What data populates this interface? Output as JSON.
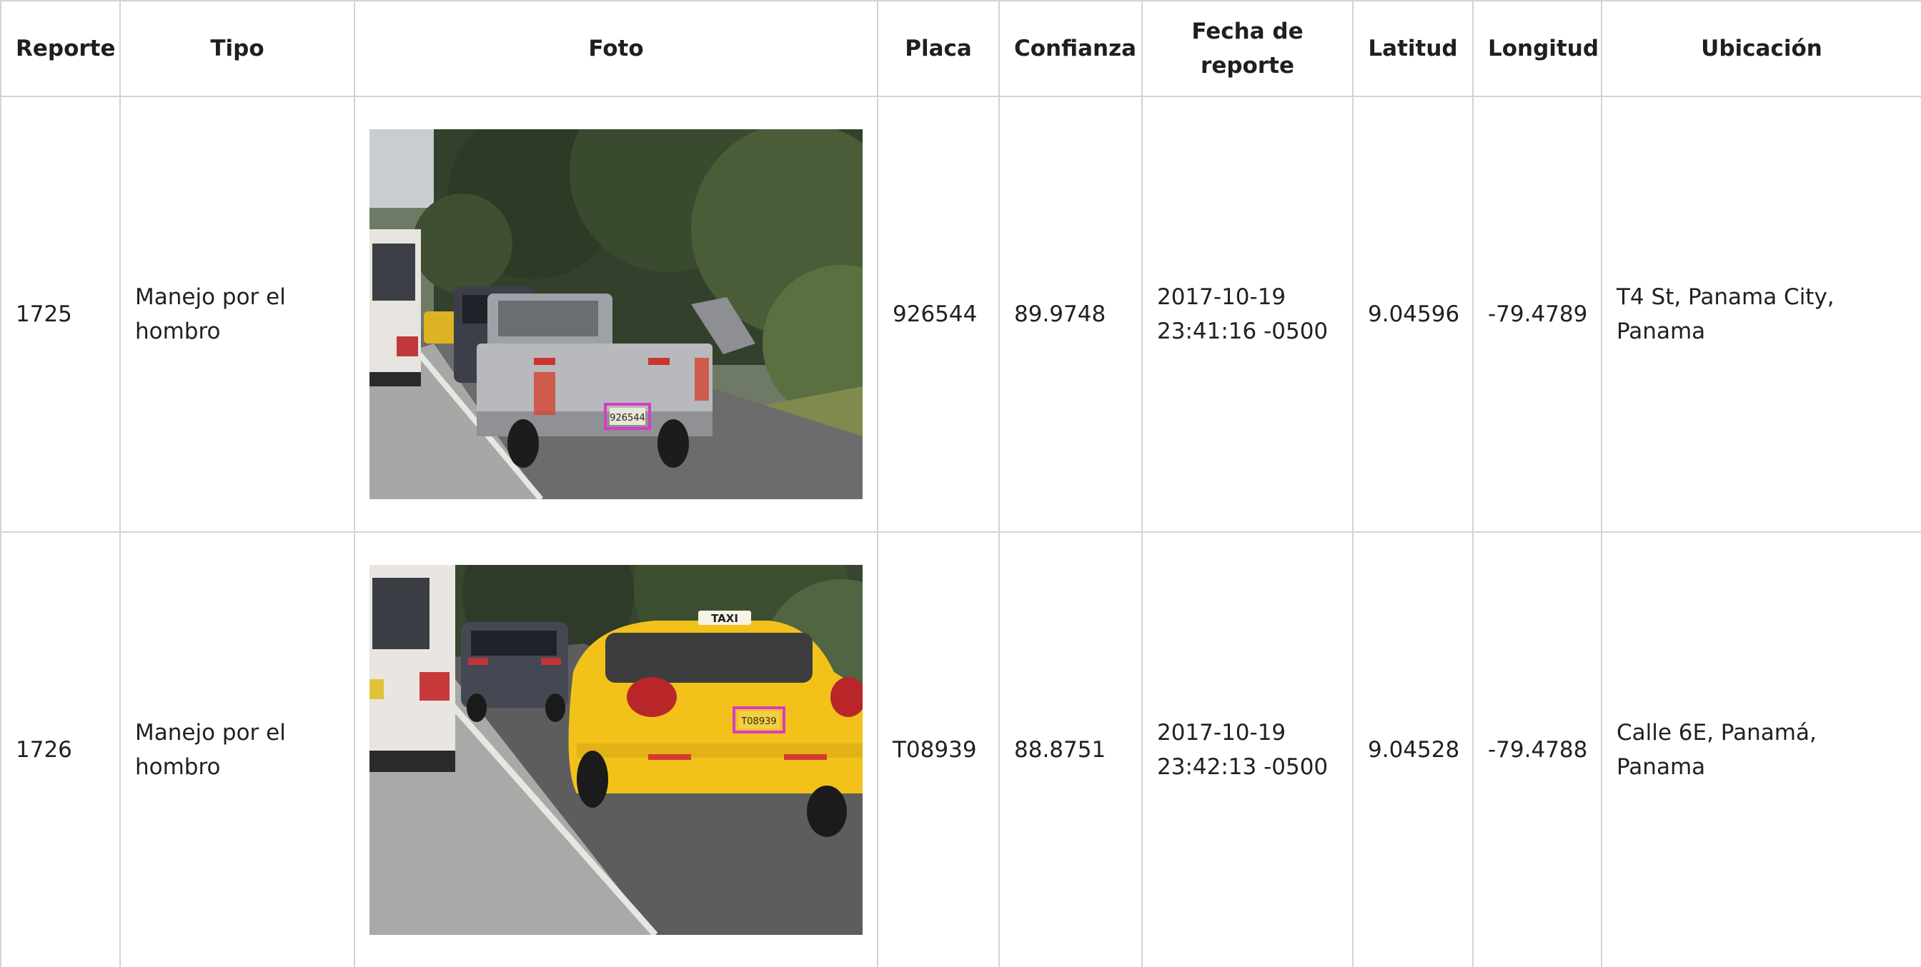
{
  "table": {
    "headers": {
      "reporte": "Reporte",
      "tipo": "Tipo",
      "foto": "Foto",
      "placa": "Placa",
      "confianza": "Confianza",
      "fecha": "Fecha de reporte",
      "latitud": "Latitud",
      "longitud": "Longitud",
      "ubicacion": "Ubicación"
    },
    "rows": [
      {
        "reporte": "1725",
        "tipo": "Manejo por el hombro",
        "placa": "926544",
        "confianza": "89.9748",
        "fecha_line1": "2017-10-19",
        "fecha_line2": "23:41:16 -0500",
        "latitud": "9.04596",
        "longitud": "-79.4789",
        "ubicacion": "T4 St, Panama City, Panama",
        "photo": {
          "description": "Silver pickup truck on road shoulder with highlighted license plate",
          "plate_text": "926544"
        }
      },
      {
        "reporte": "1726",
        "tipo": "Manejo por el hombro",
        "placa": "T08939",
        "confianza": "88.8751",
        "fecha_line1": "2017-10-19",
        "fecha_line2": "23:42:13 -0500",
        "latitud": "9.04528",
        "longitud": "-79.4788",
        "ubicacion": "Calle 6E, Panamá, Panama",
        "photo": {
          "description": "Yellow taxi driving on road shoulder with highlighted license plate",
          "plate_text": "T08939",
          "roof_sign": "TAXI"
        }
      }
    ]
  },
  "colors": {
    "border": "#d3d3d3",
    "text": "#212121",
    "plate_highlight": "#d63cc7",
    "taxi_yellow": "#f2c21b"
  }
}
